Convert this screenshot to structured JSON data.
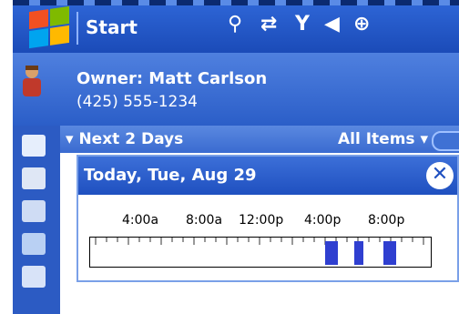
{
  "titlebar": {
    "title": "Start"
  },
  "owner": {
    "label": "Owner: Matt Carlson",
    "phone": "(425) 555-1234"
  },
  "agenda": {
    "range_label": "Next 2 Days",
    "filter_label": "All Items"
  },
  "popup": {
    "title": "Today, Tue, Aug 29",
    "time_labels": [
      "4:00a",
      "8:00a",
      "12:00p",
      "4:00p",
      "8:00p"
    ]
  },
  "colors": {
    "titlebar": "#2f67d8",
    "busy_block": "#2f3fd0"
  },
  "icons": {
    "start": "windows-logo-icon",
    "search": "search-icon",
    "sync": "sync-icon",
    "signal": "signal-icon",
    "volume": "volume-icon",
    "connectivity": "connectivity-icon",
    "close": "close-icon"
  }
}
